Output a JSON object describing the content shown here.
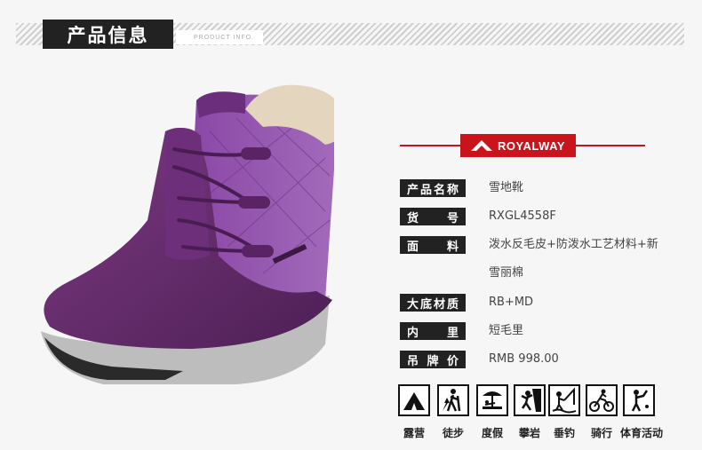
{
  "header": {
    "title": "产品信息",
    "subtitle": "PRODUCT INFO."
  },
  "brand": {
    "name": "ROYALWAY",
    "color": "#c9141c"
  },
  "product": {
    "image": "purple-snow-boot"
  },
  "specs": [
    {
      "label_chars": [
        "产",
        "品",
        "名",
        "称"
      ],
      "value_lines": [
        "雪地靴"
      ]
    },
    {
      "label_chars": [
        "货",
        "号"
      ],
      "value_lines": [
        "RXGL4558F"
      ]
    },
    {
      "label_chars": [
        "面",
        "料"
      ],
      "value_lines": [
        "泼水反毛皮+防泼水工艺材料+新",
        "雪丽棉"
      ]
    },
    {
      "label_chars": [
        "大",
        "底",
        "材",
        "质"
      ],
      "value_lines": [
        "RB+MD"
      ]
    },
    {
      "label_chars": [
        "内",
        "里"
      ],
      "value_lines": [
        "短毛里"
      ]
    },
    {
      "label_chars": [
        "吊",
        "牌",
        "价"
      ],
      "value_lines": [
        "RMB 998.00"
      ]
    }
  ],
  "activities": [
    {
      "label": "露营",
      "icon": "camping-icon"
    },
    {
      "label": "徒步",
      "icon": "hiking-icon"
    },
    {
      "label": "度假",
      "icon": "vacation-icon"
    },
    {
      "label": "攀岩",
      "icon": "climbing-icon"
    },
    {
      "label": "垂钓",
      "icon": "fishing-icon"
    },
    {
      "label": "骑行",
      "icon": "cycling-icon"
    },
    {
      "label": "体育活动",
      "icon": "sports-icon"
    }
  ]
}
